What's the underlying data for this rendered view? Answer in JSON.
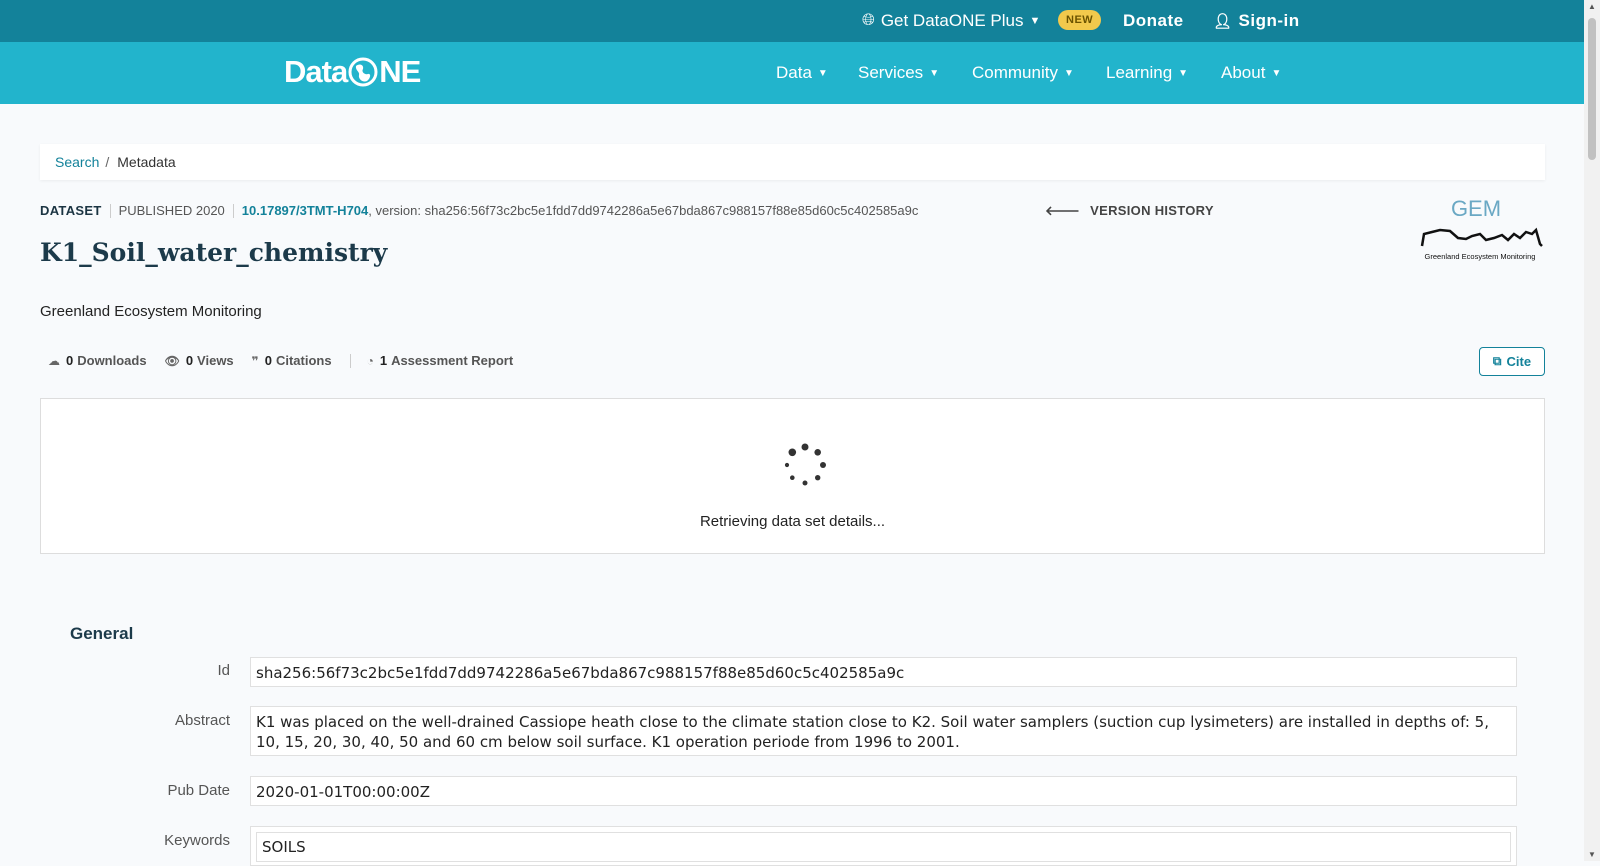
{
  "topbar": {
    "plus_label": "Get DataONE Plus",
    "new_badge": "NEW",
    "donate": "Donate",
    "signin": "Sign-in"
  },
  "nav": {
    "logo_left": "Data",
    "logo_right": "NE",
    "items": [
      "Data",
      "Services",
      "Community",
      "Learning",
      "About"
    ]
  },
  "breadcrumb": {
    "link": "Search",
    "separator": "/",
    "current": "Metadata"
  },
  "dataset": {
    "type": "DATASET",
    "published": "PUBLISHED 2020",
    "doi": "10.17897/3TMT-H704",
    "version": ", version: sha256:56f73c2bc5e1fdd7dd9742286a5e67bda867c988157f88e85d60c5c402585a9c",
    "version_history": "VERSION HISTORY",
    "title": "K1_Soil_water_chemistry",
    "organization": "Greenland Ecosystem Monitoring",
    "gem_logo_text": "GEM",
    "gem_logo_caption": "Greenland Ecosystem Monitoring"
  },
  "stats": {
    "downloads_count": "0",
    "downloads_label": "Downloads",
    "views_count": "0",
    "views_label": "Views",
    "citations_count": "0",
    "citations_label": "Citations",
    "reports_count": "1",
    "reports_label": "Assessment Report"
  },
  "cite_button": "Cite",
  "loading_text": "Retrieving data set details...",
  "general": {
    "heading": "General",
    "id_label": "Id",
    "id_value": "sha256:56f73c2bc5e1fdd7dd9742286a5e67bda867c988157f88e85d60c5c402585a9c",
    "abstract_label": "Abstract",
    "abstract_value": "K1 was placed on the well-drained Cassiope heath close to the climate station close to K2. Soil water samplers (suction cup lysimeters) are installed in depths of: 5, 10, 15, 20, 30, 40, 50 and 60 cm below soil surface. K1 operation periode from 1996 to 2001.",
    "pubdate_label": "Pub Date",
    "pubdate_value": "2020-01-01T00:00:00Z",
    "keywords_label": "Keywords",
    "keywords_value": "SOILS"
  },
  "colors": {
    "topbar": "#13829a",
    "navbar": "#22b4cc",
    "accent": "#13829a",
    "badge": "#f2c94c"
  }
}
